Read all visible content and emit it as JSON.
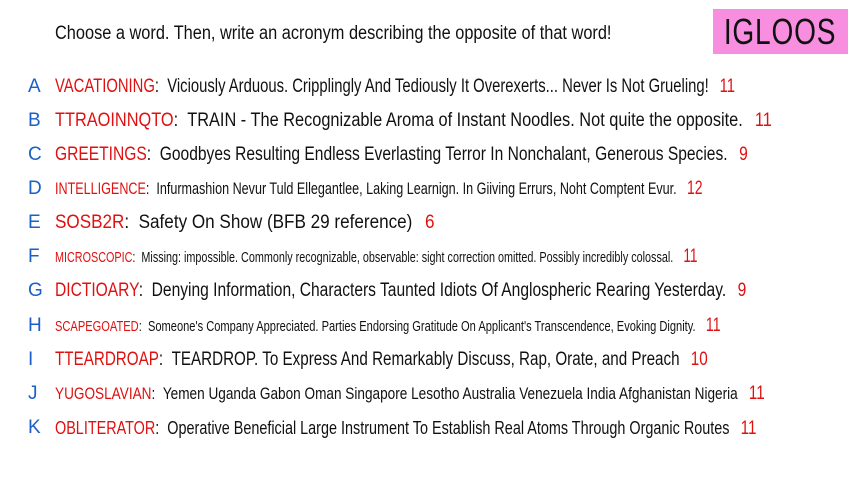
{
  "header": {
    "prompt": "Choose a word. Then, write an acronym describing the opposite of that word!",
    "title": "IGLOOS"
  },
  "entries": [
    {
      "letter": "A",
      "word": "VACATIONING",
      "colon": ":",
      "text": "Viciously Arduous. Cripplingly And Tediously It Overexerts... Never Is Not Grueling!",
      "score": "11"
    },
    {
      "letter": "B",
      "word": "TTRAOINNQTO",
      "colon": ":",
      "text": "TRAIN - The Recognizable Aroma of Instant Noodles. Not quite the opposite.",
      "score": "11"
    },
    {
      "letter": "C",
      "word": "GREETINGS",
      "colon": ":",
      "text": "Goodbyes Resulting Endless Everlasting Terror In Nonchalant, Generous Species.",
      "score": "9"
    },
    {
      "letter": "D",
      "word": "INTELLIGENCE",
      "colon": ":",
      "text": "Infurmashion Nevur Tuld Ellegantlee, Laking Learnign. In Giiving Errurs, Noht Comptent Evur.",
      "score": "12"
    },
    {
      "letter": "E",
      "word": "SOSB2R",
      "colon": ":",
      "text": "Safety On Show (BFB 29 reference)",
      "score": "6"
    },
    {
      "letter": "F",
      "word": "MICROSCOPIC",
      "colon": ":",
      "text": "Missing: impossible. Commonly recognizable, observable: sight correction omitted. Possibly incredibly colossal.",
      "score": "11"
    },
    {
      "letter": "G",
      "word": "DICTIOARY",
      "colon": ":",
      "text": "Denying Information, Characters Taunted Idiots Of Anglospheric Rearing Yesterday.",
      "score": "9"
    },
    {
      "letter": "H",
      "word": "SCAPEGOATED",
      "colon": ":",
      "text": "Someone's Company Appreciated. Parties Endorsing Gratitude On Applicant's Transcendence, Evoking Dignity.",
      "score": "11"
    },
    {
      "letter": "I",
      "word": "TTEARDROAP",
      "colon": ":",
      "text": "TEARDROP. To Express And Remarkably Discuss, Rap, Orate, and Preach",
      "score": "10"
    },
    {
      "letter": "J",
      "word": "YUGOSLAVIAN",
      "colon": ":",
      "text": "Yemen Uganda Gabon Oman Singapore Lesotho Australia Venezuela India Afghanistan Nigeria",
      "score": "11"
    },
    {
      "letter": "K",
      "word": "OBLITERATOR",
      "colon": ":",
      "text": "Operative Beneficial Large Instrument To Establish Real Atoms Through Organic Routes",
      "score": "11"
    }
  ]
}
